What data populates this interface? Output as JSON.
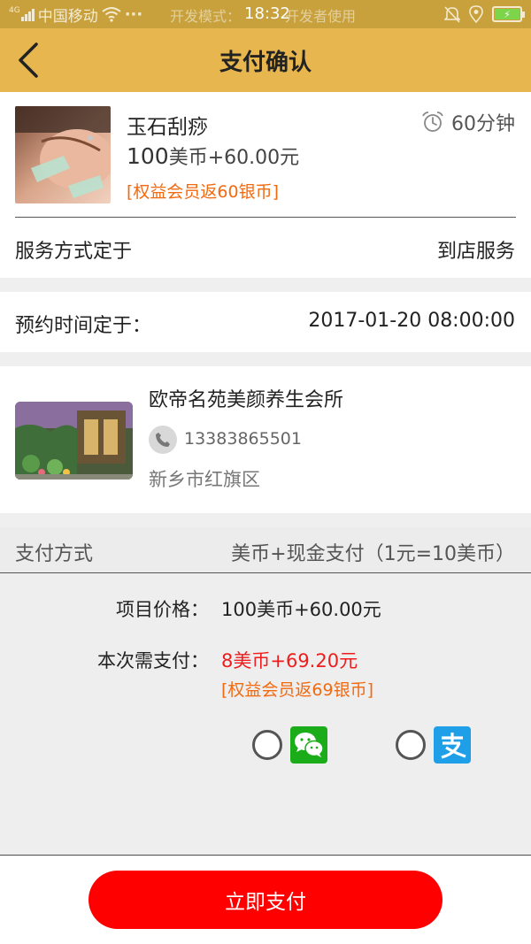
{
  "status_bar": {
    "carrier": "中国移动",
    "network_badge": "4G",
    "dev_mode_text": "开发模式：",
    "time": "18:32",
    "dev_use_text": "开发者使用",
    "dots": "···",
    "battery_color": "#7cd54a"
  },
  "header": {
    "title": "支付确认",
    "background": "#e7b64e"
  },
  "service": {
    "name": "玉石刮痧",
    "duration": "60分钟",
    "price_number": "100",
    "price_rest": "美币+60.00元",
    "rebate": "[权益会员返60银币]",
    "method_label": "服务方式定于",
    "method_value": "到店服务"
  },
  "appointment": {
    "label": "预约时间定于：",
    "value": "2017-01-20 08:00:00"
  },
  "shop": {
    "name": "欧帝名苑美颜养生会所",
    "phone": "13383865501",
    "address": "新乡市红旗区"
  },
  "payment": {
    "method_label": "支付方式",
    "method_value": "美币+现金支付（1元=10美币）",
    "item_price_label": "项目价格：",
    "item_price_value": "100美币+60.00元",
    "due_label": "本次需支付：",
    "due_value": "8美币+69.20元",
    "due_rebate": "[权益会员返69银币]",
    "options": [
      "wechat-pay",
      "alipay"
    ],
    "accent_red": "#ee1c1c",
    "rebate_orange": "#f26a10"
  },
  "action": {
    "pay_now": "立即支付",
    "button_color": "#ff0000"
  }
}
